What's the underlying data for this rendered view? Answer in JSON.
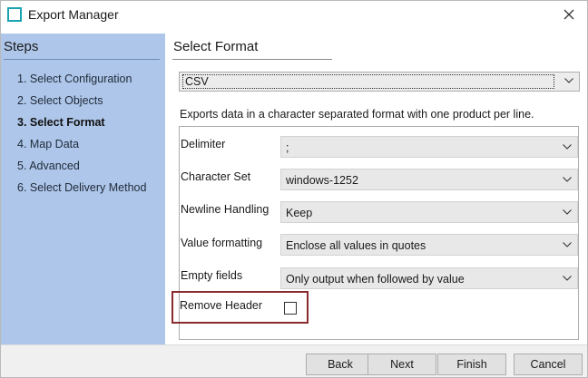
{
  "window": {
    "title": "Export Manager",
    "icon": "window-icon",
    "close_icon": "close-icon",
    "accent_color": "#1aa3b0"
  },
  "steps": {
    "header": "Steps",
    "items": [
      {
        "label": "1. Select Configuration",
        "active": false
      },
      {
        "label": "2. Select Objects",
        "active": false
      },
      {
        "label": "3. Select Format",
        "active": true
      },
      {
        "label": "4. Map Data",
        "active": false
      },
      {
        "label": "5. Advanced",
        "active": false
      },
      {
        "label": "6. Select Delivery Method",
        "active": false
      }
    ],
    "panel_color": "#aec6e9"
  },
  "main": {
    "section_title": "Select Format",
    "format": {
      "selected": "CSV"
    },
    "description": "Exports data in a character separated format with one product per line.",
    "options": {
      "delimiter": {
        "label": "Delimiter",
        "value": ";"
      },
      "charset": {
        "label": "Character Set",
        "value": "windows-1252"
      },
      "newline": {
        "label": "Newline Handling",
        "value": "Keep"
      },
      "value_formatting": {
        "label": "Value formatting",
        "value": "Enclose all values in quotes"
      },
      "empty_fields": {
        "label": "Empty fields",
        "value": "Only output when followed by value"
      },
      "remove_header": {
        "label": "Remove Header",
        "checked": false
      }
    },
    "highlight_color": "#8b2b2b"
  },
  "footer": {
    "back": "Back",
    "next": "Next",
    "finish": "Finish",
    "cancel": "Cancel"
  }
}
